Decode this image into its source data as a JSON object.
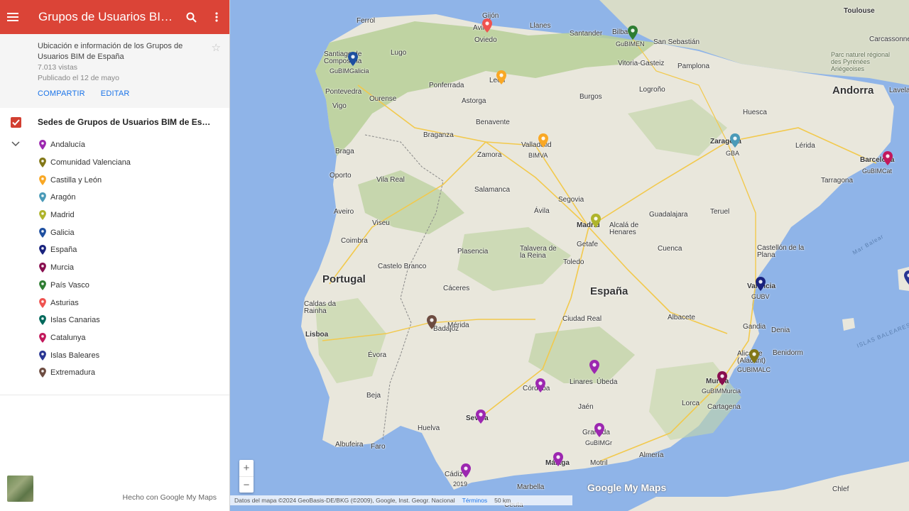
{
  "sidebar": {
    "title": "Grupos de Usuarios BIM d...",
    "description": "Ubicación e información de los Grupos de Usuarios BIM de España",
    "views": "7.013 vistas",
    "published": "Publicado el 12 de mayo",
    "share_label": "COMPARTIR",
    "edit_label": "EDITAR",
    "layer_name": "Sedes de Grupos de Usuarios BIM de Espa...",
    "legend": [
      {
        "label": "Andalucía",
        "color": "#9c27b0"
      },
      {
        "label": "Comunidad Valenciana",
        "color": "#827717"
      },
      {
        "label": "Castilla y León",
        "color": "#f9a825"
      },
      {
        "label": "Aragón",
        "color": "#4a9ab8"
      },
      {
        "label": "Madrid",
        "color": "#afb42b"
      },
      {
        "label": "Galicia",
        "color": "#1e4fa0"
      },
      {
        "label": "España",
        "color": "#1a237e"
      },
      {
        "label": "Murcia",
        "color": "#880e4f"
      },
      {
        "label": "País Vasco",
        "color": "#2e7d32"
      },
      {
        "label": "Asturias",
        "color": "#ef5350"
      },
      {
        "label": "Islas Canarias",
        "color": "#00695c"
      },
      {
        "label": "Catalunya",
        "color": "#c2185b"
      },
      {
        "label": "Islas Baleares",
        "color": "#283593"
      },
      {
        "label": "Extremadura",
        "color": "#6d4c41"
      }
    ],
    "made_with": "Hecho con Google My Maps"
  },
  "map": {
    "labels": {
      "portugal": "Portugal",
      "espana": "España",
      "andorra": "Andorra",
      "gijon": "Gijón",
      "oviedo": "Oviedo",
      "avil": "Avil",
      "ferrol": "Ferrol",
      "lugo": "Lugo",
      "santiago": "Santiago de Compostela",
      "gubimgalicia": "GuBIMGalicia",
      "pontevedra": "Pontevedra",
      "ourense": "Ourense",
      "vigo": "Vigo",
      "ponferrada": "Ponferrada",
      "leon": "León",
      "astorga": "Astorga",
      "llanes": "Llanes",
      "santander": "Santander",
      "bilbao": "Bilbao",
      "gubimen": "GuBIMEN",
      "sansebastian": "San Sebastián",
      "vitoria": "Vitoria-Gasteiz",
      "pamplona": "Pamplona",
      "burgos": "Burgos",
      "logrono": "Logroño",
      "benavente": "Benavente",
      "valladolid": "Valladolid",
      "bimva": "BIMVA",
      "zamora": "Zamora",
      "braganza": "Braganza",
      "braga": "Braga",
      "oporto": "Oporto",
      "vilareal": "Vila Real",
      "aveiro": "Aveiro",
      "viseu": "Viseu",
      "coimbra": "Coimbra",
      "salamanca": "Salamanca",
      "avila": "Ávila",
      "segovia": "Segovia",
      "madrid": "Madrid",
      "getafe": "Getafe",
      "alcala": "Alcalá de Henares",
      "guadalajara": "Guadalajara",
      "toledo": "Toledo",
      "talavera": "Talavera de la Reina",
      "plasencia": "Plasencia",
      "castelobranco": "Castelo Branco",
      "caceres": "Cáceres",
      "badajoz": "Badajoz",
      "merida": "Mérida",
      "lisboa": "Lisboa",
      "caldas": "Caldas da Rainha",
      "evora": "Évora",
      "beja": "Beja",
      "ciudadreal": "Ciudad Real",
      "cuenca": "Cuenca",
      "albacete": "Albacete",
      "huesca": "Huesca",
      "zaragoza": "Zaragoza",
      "gba": "GBA",
      "lleida": "Lérida",
      "barcelona": "Barcelona",
      "gubimcat": "GuBIMCat",
      "tarragona": "Tarragona",
      "teruel": "Teruel",
      "castellon": "Castellón de la Plana",
      "valencia": "Valencia",
      "gubv": "GUBV",
      "gandia": "Gandia",
      "denia": "Denia",
      "alicante": "Alicante (Alacant)",
      "benidorm": "Benidorm",
      "gubimalc": "GUBIMALC",
      "murcia": "Murcia",
      "gubimmurcia": "GuBIMMurcia",
      "cartagena": "Cartagena",
      "lorca": "Lorca",
      "almeria": "Almería",
      "cordoba": "Córdoba",
      "linares": "Linares",
      "ubeda": "Úbeda",
      "jaen": "Jaén",
      "granada": "Granada",
      "gubimgr": "GuBIMGr",
      "sevilla": "Sevilla",
      "huelva": "Huelva",
      "albufeira": "Albufeira",
      "faro": "Faro",
      "cadiz": "Cádiz",
      "year2019": "2019",
      "malaga": "Málaga",
      "motril": "Motril",
      "marbella": "Marbella",
      "ceuta": "Ceuta",
      "chlef": "Chlef",
      "toulouse": "Toulouse",
      "carcassonne": "Carcassonne",
      "parc": "Parc naturel régional des Pyrénées Ariégeoises",
      "lavelanet": "Lavelanet",
      "marbalear": "Mar Balear",
      "islasbaleares": "ISLAS BALEARES"
    },
    "zoom_in": "+",
    "zoom_out": "−",
    "logo_text": "Google My Maps",
    "attribution": "Datos del mapa ©2024 GeoBasis-DE/BKG (©2009), Google, Inst. Geogr. Nacional",
    "terms": "Términos",
    "scale": "50 km"
  }
}
